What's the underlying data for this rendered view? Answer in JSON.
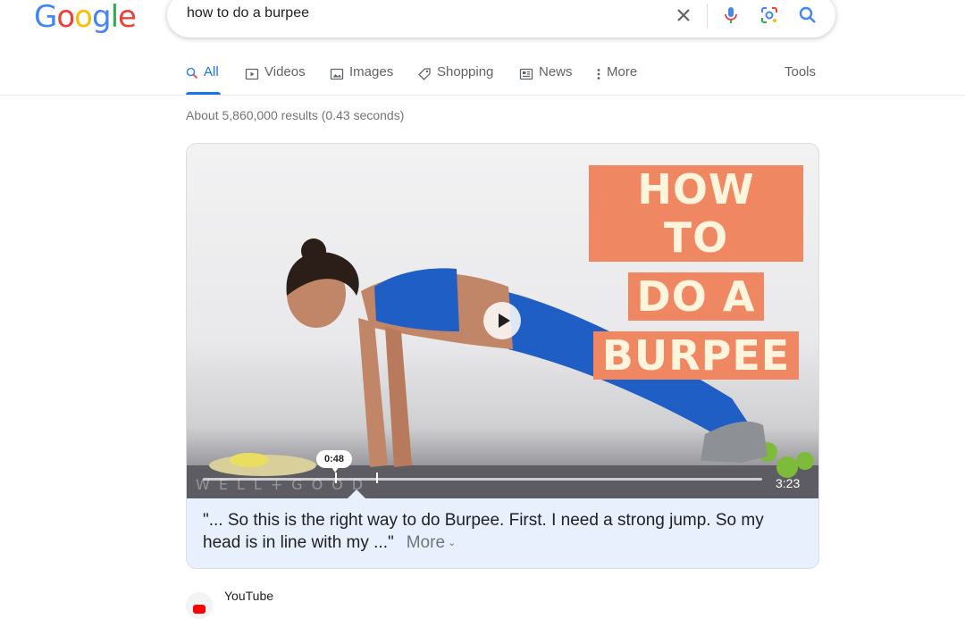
{
  "logo": {
    "letters": [
      "G",
      "o",
      "o",
      "g",
      "l",
      "e"
    ],
    "colors": [
      "#4285f4",
      "#ea4335",
      "#fbbc05",
      "#4285f4",
      "#34a853",
      "#ea4335"
    ]
  },
  "search": {
    "query": "how to do a burpee"
  },
  "icons": {
    "clear": "close-icon",
    "voice": "microphone-icon",
    "lens": "lens-icon",
    "search": "search-icon"
  },
  "tabs": [
    {
      "label": "All",
      "icon": "search-icon",
      "active": true
    },
    {
      "label": "Videos",
      "icon": "play-icon"
    },
    {
      "label": "Images",
      "icon": "image-icon"
    },
    {
      "label": "Shopping",
      "icon": "tag-icon"
    },
    {
      "label": "News",
      "icon": "news-icon"
    },
    {
      "label": "More",
      "icon": "kebab-icon"
    }
  ],
  "tools_label": "Tools",
  "stats": "About 5,860,000 results (0.43 seconds)",
  "video": {
    "thumb_title": [
      "HOW TO",
      "DO A",
      "BURPEE"
    ],
    "watermark": "WELL+GOOD",
    "current_time": "0:48",
    "duration": "3:23",
    "progress_fraction": 0.24
  },
  "caption": {
    "text": "\"... So this is the right way to do Burpee. First. I need a strong jump. So my head is in line with my ...\"",
    "more": "More"
  },
  "source": {
    "name": "YouTube"
  },
  "accent": "#1a73e8"
}
